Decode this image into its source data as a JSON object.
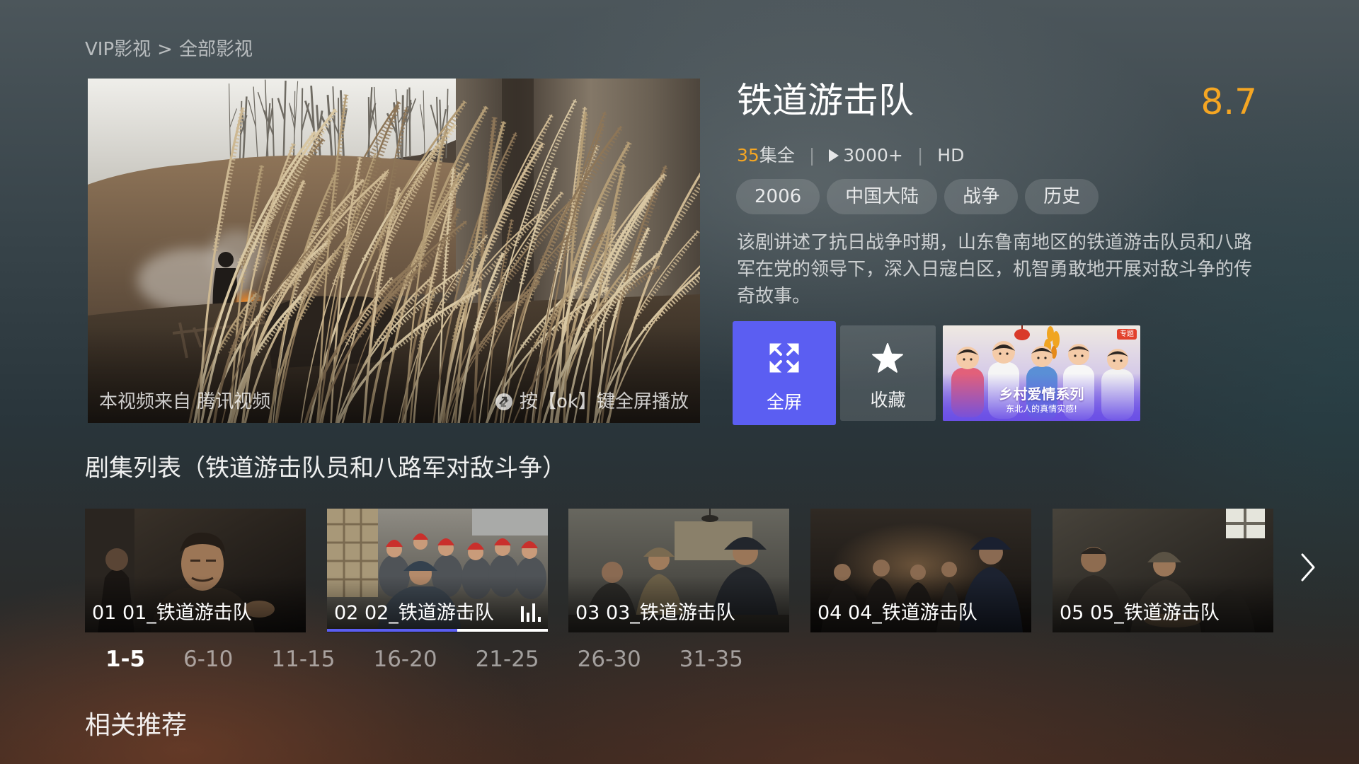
{
  "breadcrumb": {
    "root": "VIP影视",
    "separator": ">",
    "current": "全部影视"
  },
  "video": {
    "source_text": "本视频来自 腾讯视频",
    "hint_text": "按【ok】键全屏播放",
    "hint_icon": "fullscreen-hint-icon"
  },
  "show": {
    "title": "铁道游击队",
    "rating": "8.7",
    "episode_count": "35",
    "episode_status": "集全",
    "separator": "|",
    "play_icon": "play-icon",
    "play_count": "3000+",
    "quality": "HD",
    "tags": [
      "2006",
      "中国大陆",
      "战争",
      "历史"
    ],
    "description": "该剧讲述了抗日战争时期，山东鲁南地区的铁道游击队员和八路军在党的领导下，深入日寇白区，机智勇敢地开展对敌斗争的传奇故事。"
  },
  "actions": {
    "fullscreen_label": "全屏",
    "fullscreen_icon": "expand-icon",
    "favorite_label": "收藏",
    "favorite_icon": "star-icon"
  },
  "promo": {
    "title": "乡村爱情系列",
    "subtitle": "东北人的真情实感!",
    "badge": "专题"
  },
  "episodes": {
    "section_title": "剧集列表（铁道游击队员和八路军对敌斗争）",
    "items": [
      {
        "label": "01 01_铁道游击队"
      },
      {
        "label": "02 02_铁道游击队",
        "playing": true,
        "playing_icon": "equalizer-icon",
        "progress": 0.59
      },
      {
        "label": "03 03_铁道游击队"
      },
      {
        "label": "04 04_铁道游击队"
      },
      {
        "label": "05 05_铁道游击队"
      }
    ],
    "next_icon": "chevron-right-icon",
    "pages": [
      "1-5",
      "6-10",
      "11-15",
      "16-20",
      "21-25",
      "26-30",
      "31-35"
    ],
    "active_page": "1-5"
  },
  "related": {
    "title": "相关推荐"
  },
  "colors": {
    "accent": "#5b5ef2",
    "rating": "#f5a623"
  }
}
